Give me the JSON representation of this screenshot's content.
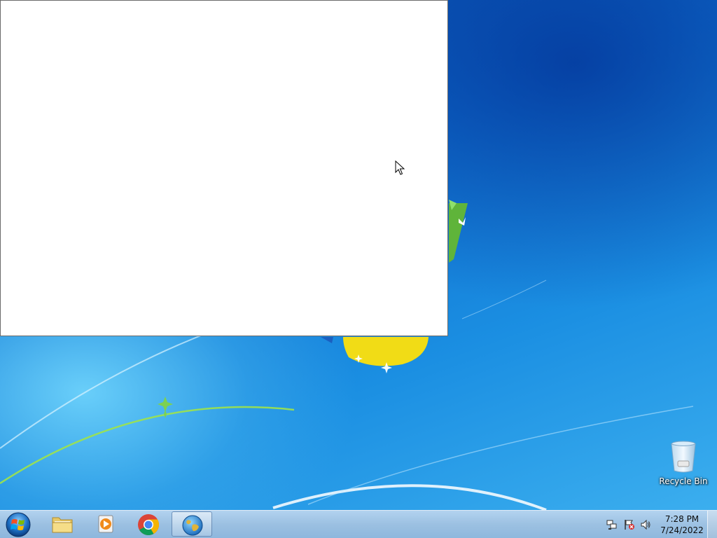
{
  "desktop": {
    "icons": [
      {
        "label": "Recycle Bin",
        "icon": "recycle-bin-icon"
      }
    ]
  },
  "window": {
    "state": "blank"
  },
  "taskbar": {
    "start_icon": "windows-logo-icon",
    "pinned": [
      {
        "name": "Windows Explorer",
        "icon": "folder-icon"
      },
      {
        "name": "Windows Media Player",
        "icon": "media-player-icon"
      },
      {
        "name": "Google Chrome",
        "icon": "chrome-icon"
      },
      {
        "name": "Internet browser",
        "icon": "globe-icon",
        "active": true
      }
    ],
    "tray": {
      "icons": [
        "network-icon",
        "action-center-flag-icon",
        "volume-icon"
      ],
      "time": "7:28 PM",
      "date": "7/24/2022"
    }
  },
  "colors": {
    "desktop_blue": "#0f6fd0",
    "taskbar": "#a5c3e1"
  }
}
